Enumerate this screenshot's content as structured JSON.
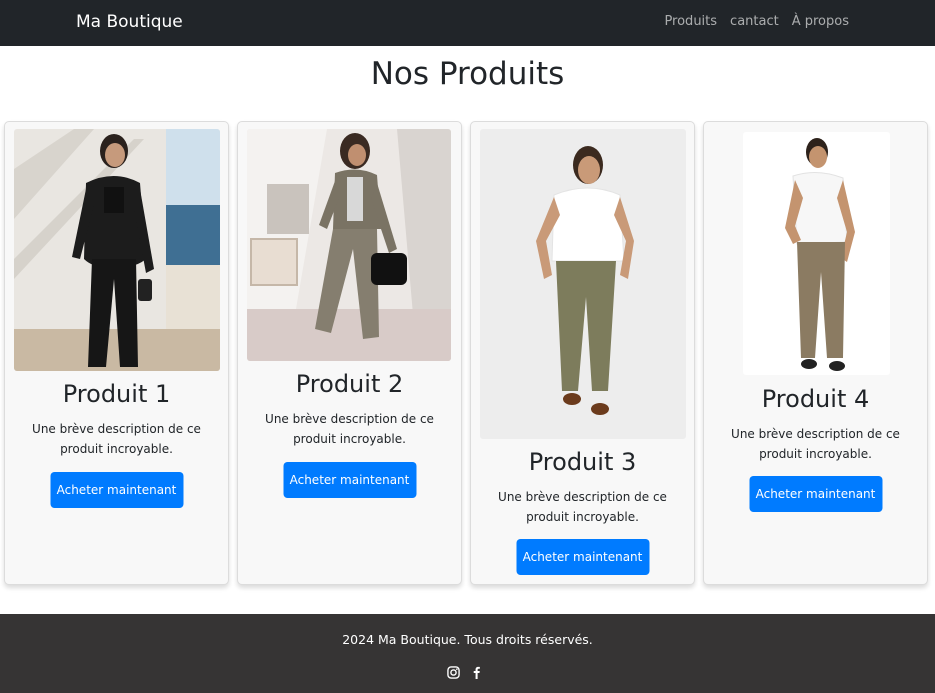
{
  "navbar": {
    "brand": "Ma Boutique",
    "links": [
      "Produits",
      "cantact",
      "À propos"
    ]
  },
  "page": {
    "title": "Nos Produits"
  },
  "products": [
    {
      "name": "Produit 1",
      "description": "Une brève description de ce produit incroyable.",
      "button": "Acheter maintenant"
    },
    {
      "name": "Produit 2",
      "description": "Une brève description de ce produit incroyable.",
      "button": "Acheter maintenant"
    },
    {
      "name": "Produit 3",
      "description": "Une brève description de ce produit incroyable.",
      "button": "Acheter maintenant"
    },
    {
      "name": "Produit 4",
      "description": "Une brève description de ce produit incroyable.",
      "button": "Acheter maintenant"
    }
  ],
  "footer": {
    "text": "2024 Ma Boutique. Tous droits réservés.",
    "social_icons": [
      "instagram-icon",
      "facebook-icon"
    ]
  },
  "colors": {
    "navbar": "#212529",
    "button": "#007bff",
    "footer": "#363434",
    "card": "#f8f8f8"
  }
}
